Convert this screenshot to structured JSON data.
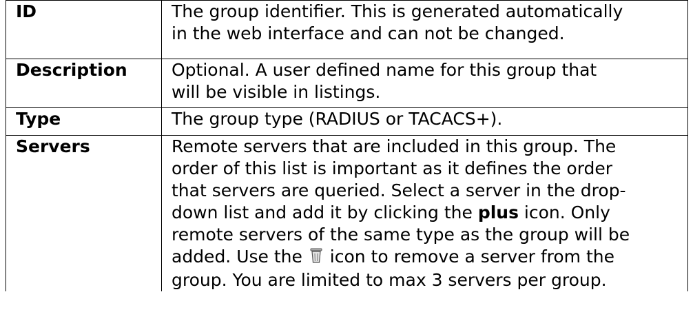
{
  "rows": [
    {
      "term": "ID",
      "lines": [
        "The group identifier. This is generated automatically",
        "in the web interface and can not be changed."
      ]
    },
    {
      "term": "Description",
      "lines": [
        "Optional. A user defined name for this group that",
        "will be visible in listings."
      ]
    },
    {
      "term": "Type",
      "lines": [
        "The group type (RADIUS or TACACS+)."
      ]
    },
    {
      "term": "Servers",
      "line1": "Remote servers that are included in this group. The",
      "line2": "order of this list is important as it defines the order",
      "line3": "that servers are queried. Select a server in the drop-",
      "line4_a": "down list and add it by clicking the ",
      "line4_bold": "plus",
      "line4_b": " icon. Only",
      "line5": "remote servers of the same type as the group will be",
      "line6_a": "added. Use the ",
      "line6_icon": "trash-icon",
      "line6_b": " icon to remove a server from the",
      "line7": "group. You are limited to max 3 servers per group."
    }
  ]
}
